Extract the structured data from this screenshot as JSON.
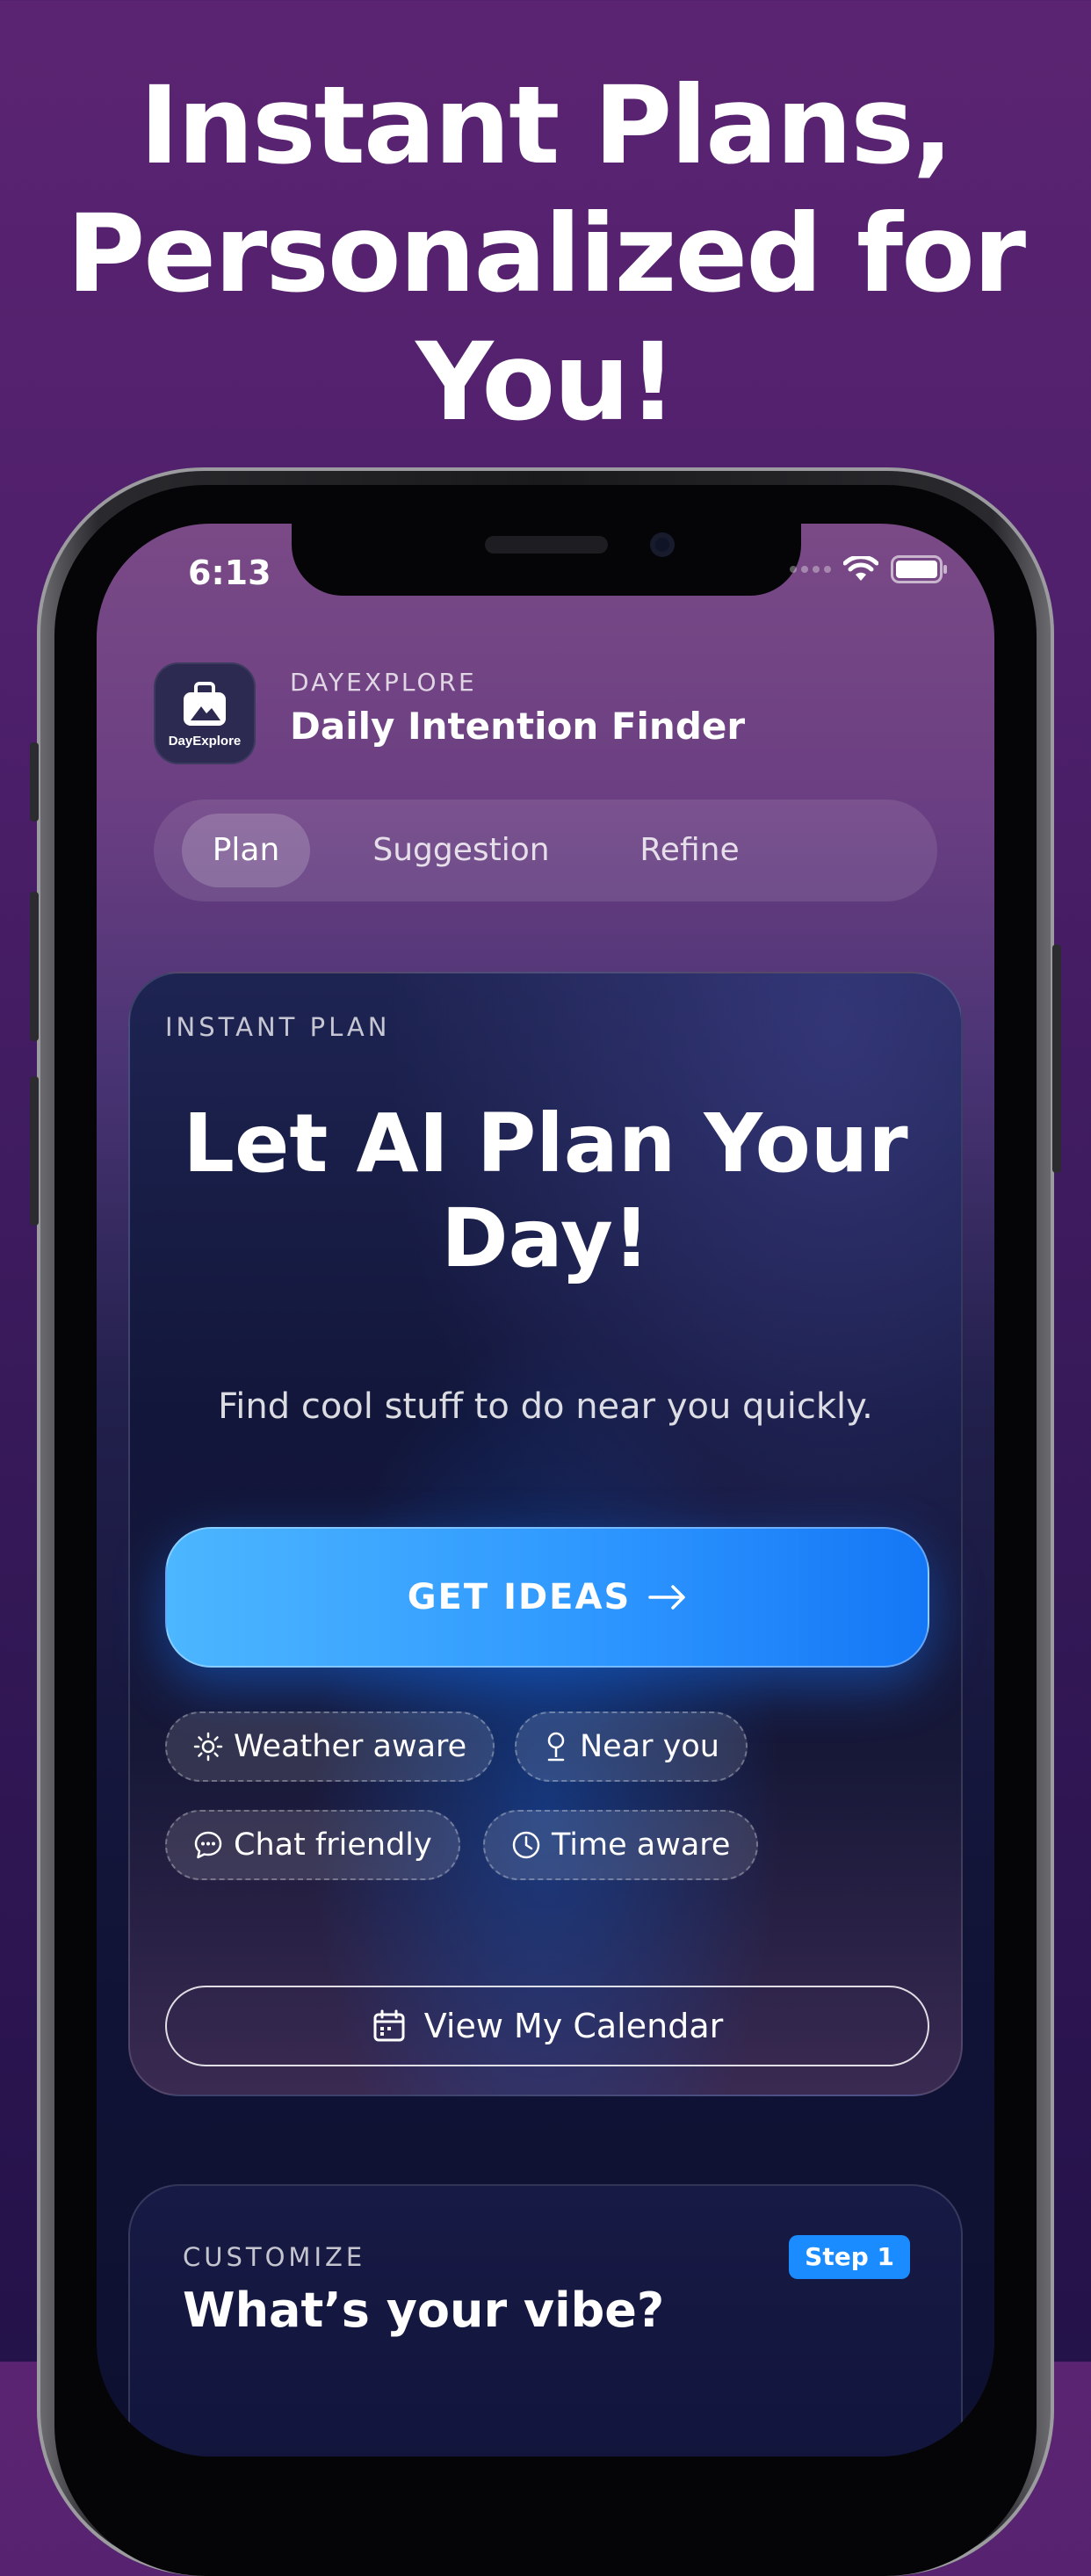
{
  "headline": {
    "line1": "Instant Plans,",
    "line2": "Personalized for",
    "line3": "You!"
  },
  "status_bar": {
    "time": "6:13"
  },
  "app": {
    "icon_label": "DayExplore",
    "eyebrow": "DAYEXPLORE",
    "title": "Daily Intention Finder"
  },
  "tabs": [
    {
      "label": "Plan",
      "active": true
    },
    {
      "label": "Suggestion",
      "active": false
    },
    {
      "label": "Refine",
      "active": false
    }
  ],
  "instant_card": {
    "eyebrow": "INSTANT PLAN",
    "title_line1": "Let AI Plan Your",
    "title_line2": "Day!",
    "subtitle": "Find cool stuff to do near you quickly.",
    "cta_label": "GET IDEAS",
    "chips": [
      {
        "label": "Weather aware",
        "icon": "sun-icon"
      },
      {
        "label": "Near you",
        "icon": "pin-icon"
      },
      {
        "label": "Chat friendly",
        "icon": "chat-icon"
      },
      {
        "label": "Time aware",
        "icon": "clock-icon"
      }
    ],
    "calendar_label": "View My Calendar"
  },
  "customize_card": {
    "eyebrow": "CUSTOMIZE",
    "title": "What’s your vibe?",
    "badge": "Step 1"
  },
  "colors": {
    "accent_blue": "#1a8cff",
    "cta_gradient_start": "#4cb6ff",
    "cta_gradient_end": "#1477f6"
  }
}
